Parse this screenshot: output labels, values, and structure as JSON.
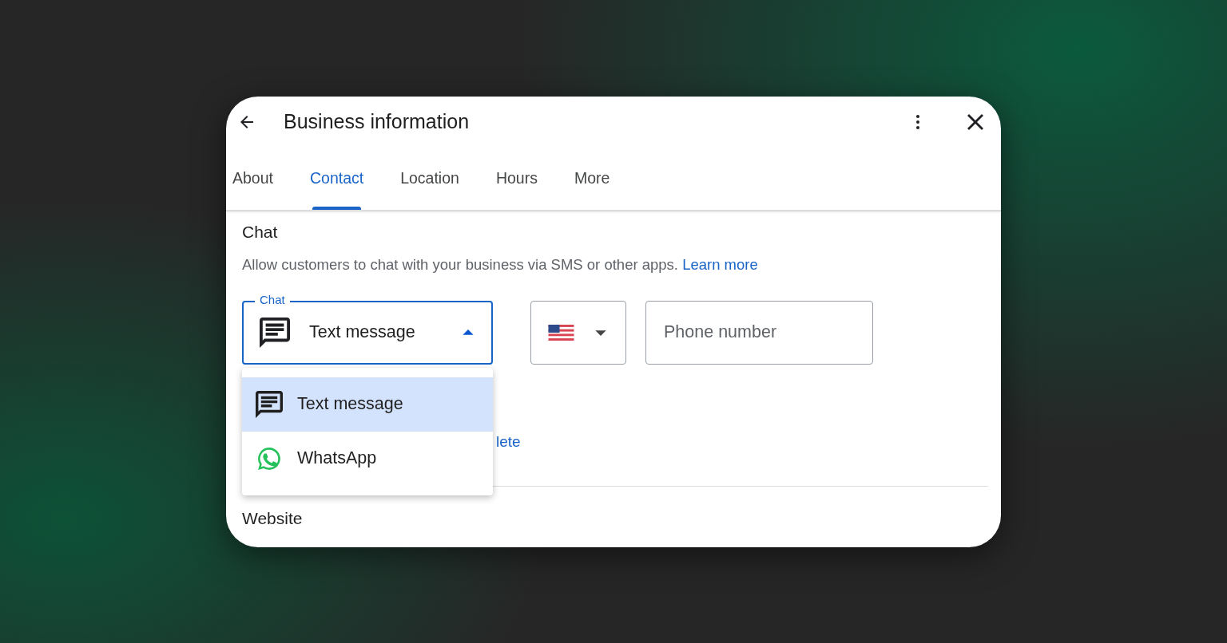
{
  "header": {
    "title": "Business information"
  },
  "tabs": [
    {
      "label": "About",
      "selected": false
    },
    {
      "label": "Contact",
      "selected": true
    },
    {
      "label": "Location",
      "selected": false
    },
    {
      "label": "Hours",
      "selected": false
    },
    {
      "label": "More",
      "selected": false
    }
  ],
  "chat_section": {
    "heading": "Chat",
    "description": "Allow customers to chat with your business via SMS or other apps.",
    "link": "Learn more",
    "chat_field": {
      "label": "Chat",
      "value": "Text message",
      "expanded": true
    },
    "options": [
      {
        "kind": "sms",
        "label": "Text message",
        "selected": true
      },
      {
        "kind": "whatsapp",
        "label": "WhatsApp",
        "selected": false
      }
    ],
    "phone_field": {
      "placeholder": "Phone number"
    },
    "partial_link": "lete"
  },
  "website_section": {
    "heading": "Website"
  }
}
